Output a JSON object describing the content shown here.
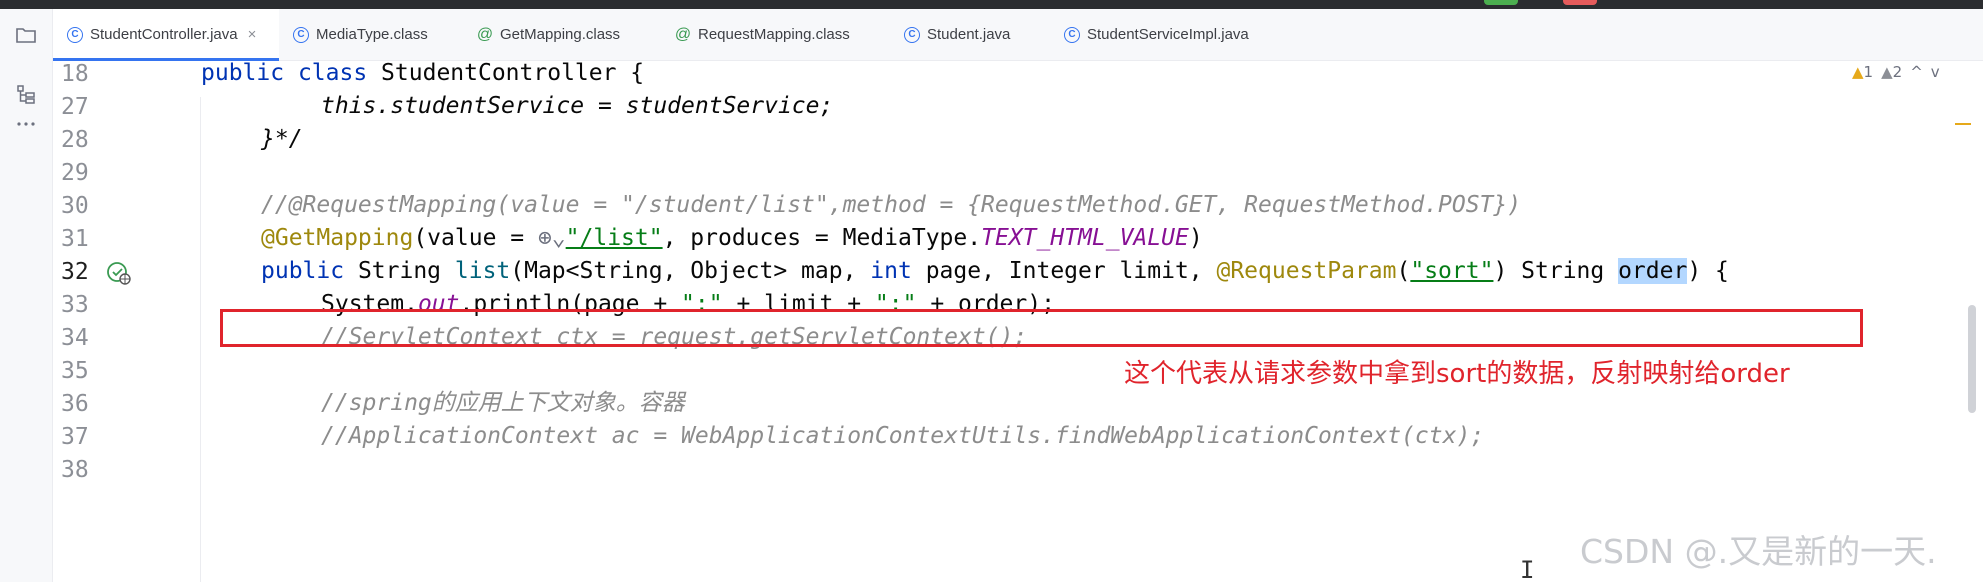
{
  "tabs": [
    {
      "label": "StudentController.java",
      "icon": "class-icon",
      "active": true,
      "close": "×"
    },
    {
      "label": "MediaType.class",
      "icon": "class-icon"
    },
    {
      "label": "GetMapping.class",
      "icon": "annotation-icon"
    },
    {
      "label": "RequestMapping.class",
      "icon": "annotation-icon"
    },
    {
      "label": "Student.java",
      "icon": "class-icon"
    },
    {
      "label": "StudentServiceImpl.java",
      "icon": "class-icon"
    }
  ],
  "tab_glyphs": {
    "class": "C",
    "annotation": "@"
  },
  "inspections": {
    "warnings": "1",
    "weak_warnings": "2",
    "up": "^",
    "down": "v"
  },
  "line_numbers": [
    "18",
    "27",
    "28",
    "29",
    "30",
    "31",
    "32",
    "33",
    "34",
    "35",
    "36",
    "37",
    "38"
  ],
  "code": {
    "l18": {
      "kw1": "public",
      "kw2": "class",
      "rest": " StudentController {"
    },
    "l27": "this.studentService = studentService;",
    "l28": "}*/",
    "l30": "//@RequestMapping(value = \"/student/list\",method = {RequestMethod.GET, RequestMethod.POST})",
    "l31": {
      "ann": "@GetMapping",
      "p1": "(value = ",
      "globe": "⊕⌄",
      "str": "\"/list\"",
      "p2": ", produces = MediaType.",
      "fld": "TEXT_HTML_VALUE",
      "p3": ")"
    },
    "l32": {
      "kw1": "public",
      "p1": " String ",
      "fn": "list",
      "p2": "(Map<String, Object> map, ",
      "kw2": "int",
      "p3": " page, Integer limit, ",
      "ann": "@RequestParam",
      "p4": "(",
      "str": "\"sort\"",
      "p5": ") String ",
      "hl": "order",
      "p6": ") {"
    },
    "l33": {
      "p1": "System.",
      "out": "out",
      "p2": ".println(page + ",
      "s1": "\":\"",
      "p3": " + limit + ",
      "s2": "\":\"",
      "p4": " + order);"
    },
    "l34": "//ServletContext ctx = request.getServletContext();",
    "l36": "//spring的应用上下文对象。容器",
    "l37": "//ApplicationContext ac = WebApplicationContextUtils.findWebApplicationContext(ctx);"
  },
  "annotation_text": "这个代表从请求参数中拿到sort的数据，反射映射给order",
  "watermark": "CSDN @.又是新的一天.",
  "colors": {
    "accent": "#3574f0",
    "annotation_red": "#e0242c",
    "keyword": "#0033b3",
    "string": "#067d17",
    "annotation": "#9e880d",
    "field": "#871094",
    "comment": "#8c8c8c"
  }
}
